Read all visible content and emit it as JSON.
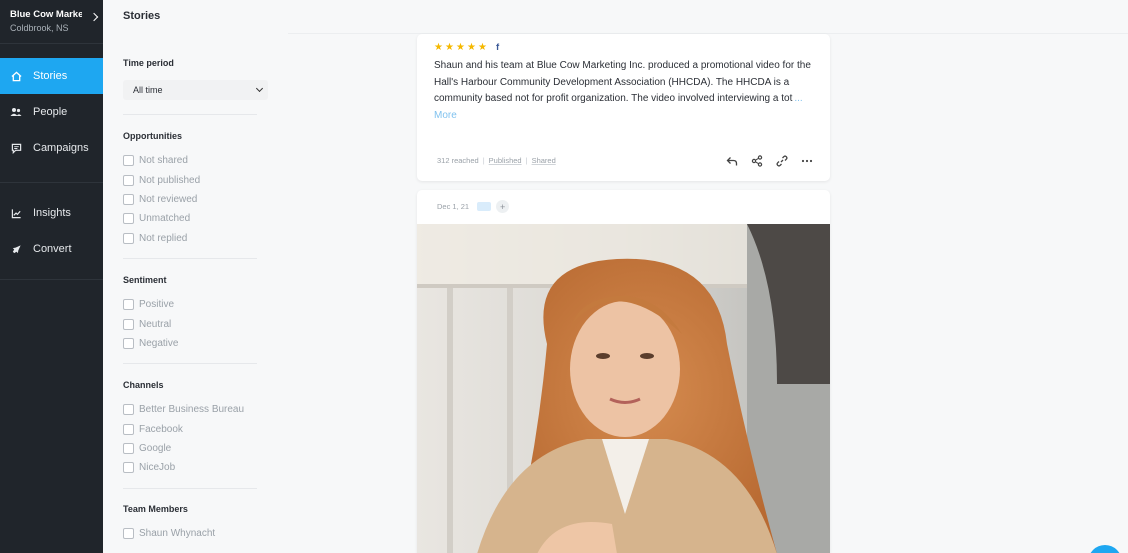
{
  "business": {
    "name": "Blue Cow Marketing Inc.",
    "location": "Coldbrook, NS"
  },
  "nav": {
    "items": [
      {
        "label": "Stories",
        "icon": "home-icon",
        "active": true
      },
      {
        "label": "People",
        "icon": "people-icon",
        "active": false
      },
      {
        "label": "Campaigns",
        "icon": "chat-icon",
        "active": false
      }
    ],
    "items2": [
      {
        "label": "Insights",
        "icon": "chart-icon",
        "active": false
      },
      {
        "label": "Convert",
        "icon": "rocket-icon",
        "active": false
      }
    ]
  },
  "page": {
    "title": "Stories"
  },
  "filters": {
    "time_period": {
      "title": "Time period",
      "selected": "All time"
    },
    "opportunities": {
      "title": "Opportunities",
      "options": [
        "Not shared",
        "Not published",
        "Not reviewed",
        "Unmatched",
        "Not replied"
      ]
    },
    "sentiment": {
      "title": "Sentiment",
      "options": [
        "Positive",
        "Neutral",
        "Negative"
      ]
    },
    "channels": {
      "title": "Channels",
      "options": [
        "Better Business Bureau",
        "Facebook",
        "Google",
        "NiceJob"
      ]
    },
    "team_members": {
      "title": "Team Members",
      "options": [
        "Shaun Whynacht"
      ]
    }
  },
  "story1": {
    "rating": 5,
    "channel_icon": "facebook-icon",
    "channel_glyph": "f",
    "text": "Shaun and his team at Blue Cow Marketing Inc. produced a promotional video for the Hall's Harbour Community Development Association (HHCDA). The HHCDA is a community based not for profit organization. The video involved interviewing a tot",
    "more_label": "... More",
    "reached": "312 reached",
    "published": "Published",
    "shared": "Shared",
    "action_icons": [
      "reply-icon",
      "share-icon",
      "link-icon",
      "more-icon"
    ]
  },
  "story2": {
    "date": "Dec 1, 21",
    "plus_label": "+"
  },
  "colors": {
    "accent": "#1ea7f1",
    "sidebar": "#20252b",
    "star": "#f5b800"
  }
}
